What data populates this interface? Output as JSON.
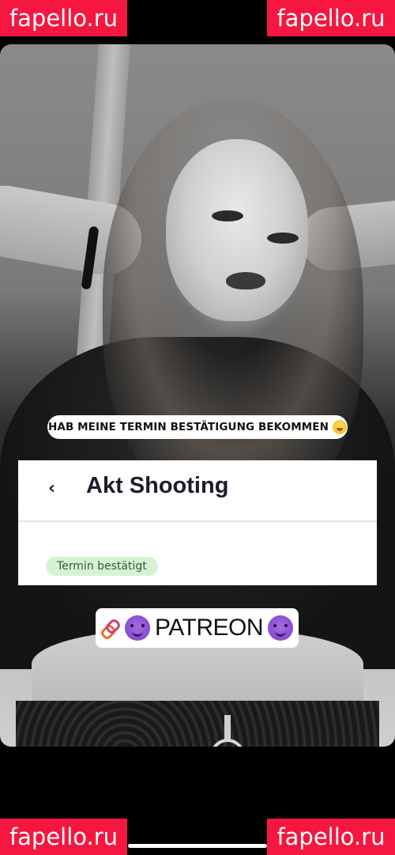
{
  "watermarks": {
    "top_left": "fapello.ru",
    "top_right": "fapello.ru",
    "bottom_left": "fapello.ru",
    "bottom_right": "fapello.ru",
    "color": "#f5173f"
  },
  "story": {
    "caption_sticker": "HAB MEINE TERMIN BESTÄTIGUNG BEKOMMEN",
    "caption_emoji": "hand-over-mouth-face-icon",
    "card": {
      "back_icon": "chevron-left-icon",
      "title": "Akt Shooting",
      "status_badge": "Termin bestätigt",
      "badge_color": "#d6f2d3"
    },
    "link_sticker": {
      "link_icon": "link-icon",
      "devil_icon": "smiling-devil-icon",
      "label": "PATREON"
    }
  }
}
